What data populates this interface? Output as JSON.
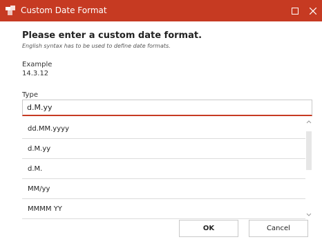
{
  "window": {
    "title": "Custom Date Format",
    "maximize_icon": "maximize-icon",
    "close_icon": "close-icon",
    "accent_color": "#c63a22"
  },
  "dialog": {
    "heading": "Please enter a custom date format.",
    "subheading": "English syntax has to be used to define date formats.",
    "example_label": "Example",
    "example_value": "14.3.12",
    "type_label": "Type",
    "type_value": "d.M.yy"
  },
  "formats": [
    {
      "label": "dd.MM.yyyy"
    },
    {
      "label": "d.M.yy"
    },
    {
      "label": "d.M."
    },
    {
      "label": "MM/yy"
    },
    {
      "label": "MMMM YY"
    }
  ],
  "buttons": {
    "ok": "OK",
    "cancel": "Cancel"
  }
}
